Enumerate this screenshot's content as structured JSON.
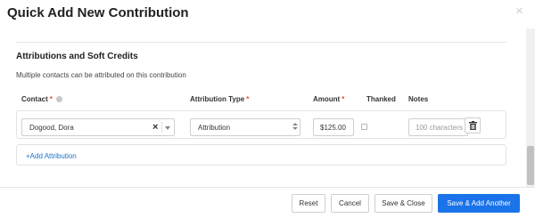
{
  "modal": {
    "title": "Quick Add New Contribution",
    "close_glyph": "×"
  },
  "attributions": {
    "title": "Attributions and Soft Credits",
    "description": "Multiple contacts can be attributed on this contribution",
    "columns": {
      "contact": "Contact",
      "attribution_type": "Attribution Type",
      "amount": "Amount",
      "thanked": "Thanked",
      "notes": "Notes"
    },
    "required_marker": "*",
    "rows": [
      {
        "contact": "Dogood, Dora",
        "attribution_type": "Attribution",
        "amount": "$125.00",
        "thanked": false,
        "notes_value": "",
        "notes_placeholder": "100 characters"
      }
    ],
    "add_label": "+Add Attribution"
  },
  "icons": {
    "clear": "clear-x-icon",
    "dropdown": "chevron-down-icon",
    "delete": "trash-icon",
    "help": "help-icon"
  },
  "colors": {
    "primary": "#1a73e8",
    "link": "#1a73c9",
    "required": "#e2463f"
  },
  "footer": {
    "reset": "Reset",
    "cancel": "Cancel",
    "save_close": "Save & Close",
    "save_add": "Save & Add Another"
  }
}
